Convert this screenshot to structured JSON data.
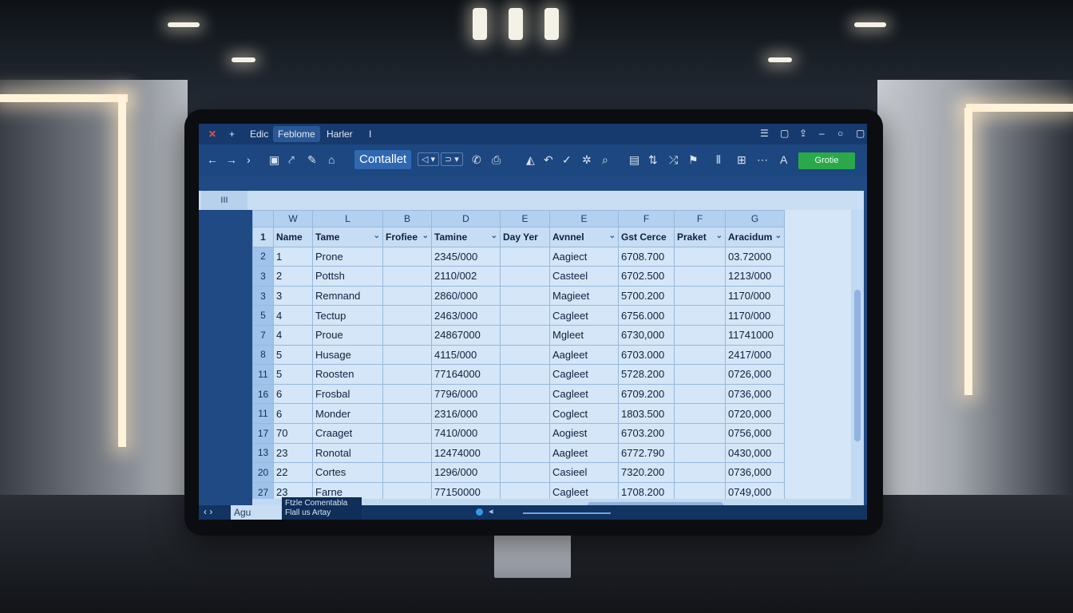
{
  "titlebar": {
    "close_glyph": "✕",
    "plus_glyph": "+",
    "menu_1": "Edic",
    "active_tab": "Feblome",
    "menu_2": "Harler",
    "menu_3": "I"
  },
  "toolbar": {
    "primary_label": "Contallet",
    "green_button": "Grotie"
  },
  "formula_bar": {
    "name_box": "III"
  },
  "columns": [
    "W",
    "L",
    "B",
    "D",
    "E",
    "E",
    "F",
    "F",
    "G"
  ],
  "header_row": {
    "row_num": "1",
    "cells": [
      "Name",
      "Tame",
      "Frofiee",
      "Tamine",
      "Day Yer",
      "Avnnel",
      "Gst Cerce",
      "Praket",
      "Aracidum"
    ]
  },
  "rows": [
    {
      "num": "2",
      "cells": [
        "1",
        "Prone",
        "",
        "2345/000",
        "",
        "Aagiect",
        "6708.700",
        "",
        "03.72000"
      ]
    },
    {
      "num": "3",
      "cells": [
        "2",
        "Pottsh",
        "",
        "2110/002",
        "",
        "Casteel",
        "6702.500",
        "",
        "1213/000"
      ]
    },
    {
      "num": "3",
      "cells": [
        "3",
        "Remnand",
        "",
        "2860/000",
        "",
        "Magieet",
        "5700.200",
        "",
        "1170/000"
      ]
    },
    {
      "num": "5",
      "cells": [
        "4",
        "Tectup",
        "",
        "2463/000",
        "",
        "Cagleet",
        "6756.000",
        "",
        "1170/000"
      ]
    },
    {
      "num": "7",
      "cells": [
        "4",
        "Proue",
        "",
        "24867000",
        "",
        "Mgleet",
        "6730,000",
        "",
        "11741000"
      ]
    },
    {
      "num": "8",
      "cells": [
        "5",
        "Husage",
        "",
        "4115/000",
        "",
        "Aagleet",
        "6703.000",
        "",
        "2417/000"
      ]
    },
    {
      "num": "11",
      "cells": [
        "5",
        "Roosten",
        "",
        "77164000",
        "",
        "Cagleet",
        "5728.200",
        "",
        "0726,000"
      ]
    },
    {
      "num": "16",
      "cells": [
        "6",
        "Frosbal",
        "",
        "7796/000",
        "",
        "Cagleet",
        "6709.200",
        "",
        "0736,000"
      ]
    },
    {
      "num": "11",
      "cells": [
        "6",
        "Monder",
        "",
        "2316/000",
        "",
        "Coglect",
        "1803.500",
        "",
        "0720,000"
      ]
    },
    {
      "num": "17",
      "cells": [
        "70",
        "Craaget",
        "",
        "7410/000",
        "",
        "Aogiest",
        "6703.200",
        "",
        "0756,000"
      ]
    },
    {
      "num": "13",
      "cells": [
        "23",
        "Ronotal",
        "",
        "12474000",
        "",
        "Aagleet",
        "6772.790",
        "",
        "0430,000"
      ]
    },
    {
      "num": "20",
      "cells": [
        "22",
        "Cortes",
        "",
        "1296/000",
        "",
        "Casieel",
        "7320.200",
        "",
        "0736,000"
      ]
    },
    {
      "num": "27",
      "cells": [
        "23",
        "Farne",
        "",
        "77150000",
        "",
        "Cagleet",
        "1708.200",
        "",
        "0749,000"
      ]
    }
  ],
  "sheet": {
    "nav": "‹ ›",
    "tab_label": "Agu",
    "tooltip_line1": "Ftzle Comentabla",
    "tooltip_line2": "Flall us Artay"
  },
  "colors": {
    "accent": "#2f68b0",
    "green": "#2aa84a",
    "screen_bg": "#1f4a84"
  }
}
